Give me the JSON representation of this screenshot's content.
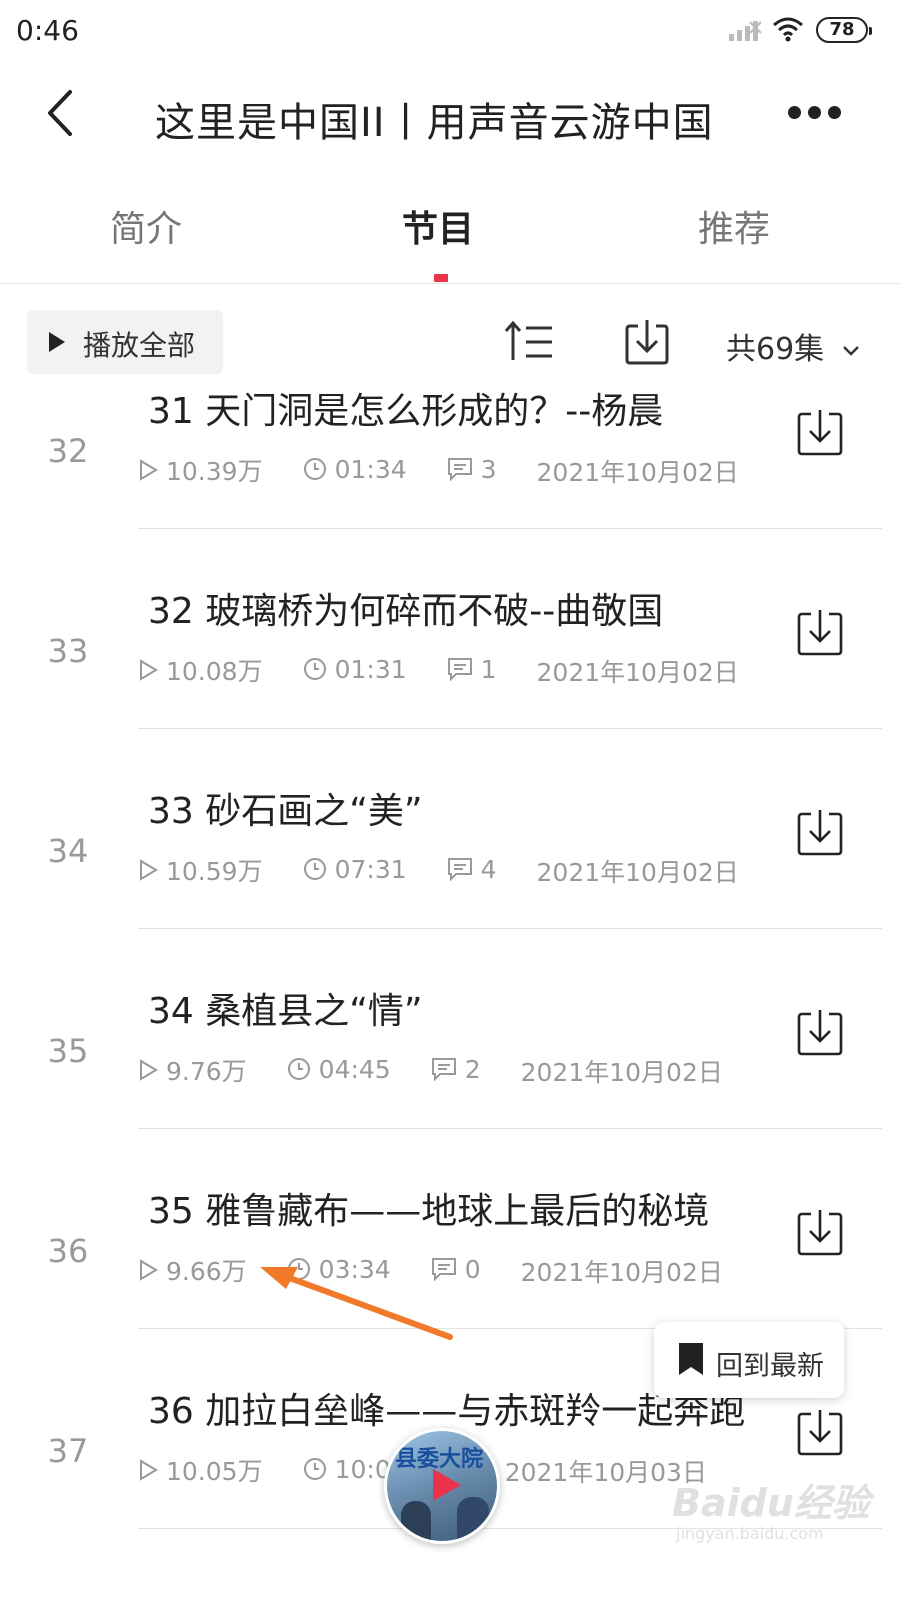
{
  "status_bar": {
    "time": "0:46",
    "battery": "78"
  },
  "header": {
    "title": "这里是中国II丨用声音云游中国"
  },
  "tabs": [
    {
      "label": "简介",
      "active": false
    },
    {
      "label": "节目",
      "active": true
    },
    {
      "label": "推荐",
      "active": false
    }
  ],
  "toolbar": {
    "play_all_label": "播放全部",
    "episode_count": "共69集"
  },
  "episodes": [
    {
      "index": "32",
      "title": "31 天门洞是怎么形成的？--杨晨",
      "plays": "10.39万",
      "duration": "01:34",
      "comments": "3",
      "date": "2021年10月02日"
    },
    {
      "index": "33",
      "title": "32 玻璃桥为何碎而不破--曲敬国",
      "plays": "10.08万",
      "duration": "01:31",
      "comments": "1",
      "date": "2021年10月02日"
    },
    {
      "index": "34",
      "title": "33 砂石画之“美”",
      "plays": "10.59万",
      "duration": "07:31",
      "comments": "4",
      "date": "2021年10月02日"
    },
    {
      "index": "35",
      "title": "34 桑植县之“情”",
      "plays": "9.76万",
      "duration": "04:45",
      "comments": "2",
      "date": "2021年10月02日"
    },
    {
      "index": "36",
      "title": "35 雅鲁藏布——地球上最后的秘境",
      "plays": "9.66万",
      "duration": "03:34",
      "comments": "0",
      "date": "2021年10月02日"
    },
    {
      "index": "37",
      "title": "36 加拉白垒峰——与赤斑羚一起奔跑",
      "plays": "10.05万",
      "duration": "10:0",
      "comments": "",
      "date": "2021年10月03日"
    }
  ],
  "floating": {
    "back_to_latest_label": "回到最新",
    "mini_player_label": "县委大院"
  },
  "watermark": {
    "brand": "Baidu经验",
    "url": "jingyan.baidu.com"
  },
  "colors": {
    "accent": "#e8334a",
    "annotation_arrow": "#f07a2a"
  }
}
